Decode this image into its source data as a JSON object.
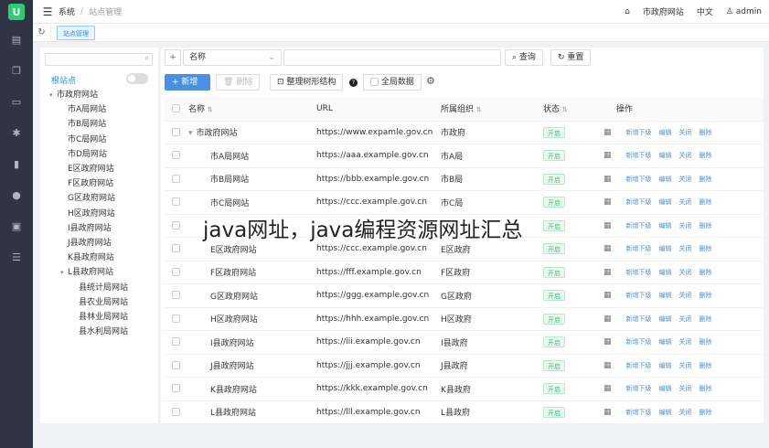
{
  "logo": "U",
  "rail": {
    "icons": [
      "document-icon",
      "copy-icon",
      "folder-icon",
      "gear-icon",
      "bar-chart-icon",
      "user-icon",
      "clipboard-icon",
      "sliders-icon"
    ]
  },
  "header": {
    "menu_label": "系统",
    "breadcrumb_current": "站点管理",
    "links": {
      "site": "市政府网站",
      "lang": "中文",
      "user": "admin"
    }
  },
  "tabs": [
    {
      "label": "站点管理"
    }
  ],
  "tree": {
    "search_placeholder": "",
    "root_label": "根站点",
    "nodes": [
      {
        "label": "市政府网站",
        "level": 0,
        "caret": "▾"
      },
      {
        "label": "市A局网站",
        "level": 1
      },
      {
        "label": "市B局网站",
        "level": 1
      },
      {
        "label": "市C局网站",
        "level": 1
      },
      {
        "label": "市D局网站",
        "level": 1
      },
      {
        "label": "E区政府网站",
        "level": 1
      },
      {
        "label": "F区政府网站",
        "level": 1
      },
      {
        "label": "G区政府网站",
        "level": 1
      },
      {
        "label": "H区政府网站",
        "level": 1
      },
      {
        "label": "I县政府网站",
        "level": 1
      },
      {
        "label": "J县政府网站",
        "level": 1
      },
      {
        "label": "K县政府网站",
        "level": 1
      },
      {
        "label": "L县政府网站",
        "level": 1,
        "caret": "▾"
      },
      {
        "label": "县统计局网站",
        "level": 2
      },
      {
        "label": "县农业局网站",
        "level": 2
      },
      {
        "label": "县林业局网站",
        "level": 2
      },
      {
        "label": "县水利局网站",
        "level": 2
      }
    ]
  },
  "filter": {
    "field_select": "名称",
    "keyword_value": "",
    "query_label": "查询",
    "reset_label": "重置"
  },
  "toolbar": {
    "add_label": "新增",
    "delete_label": "删除",
    "tree_label": "整理树形结构",
    "help_label": "?",
    "global_label": "全局数据"
  },
  "table": {
    "columns": {
      "name": "名称",
      "url": "URL",
      "org": "所属组织",
      "status": "状态",
      "ops": "操作"
    },
    "status_label": "开启",
    "op_labels": [
      "新增下级",
      "编辑",
      "关闭",
      "删除"
    ],
    "rows": [
      {
        "name": "市政府网站",
        "url": "https://www.expamle.gov.cn",
        "org": "市政府",
        "level": 0,
        "caret": "▾"
      },
      {
        "name": "市A局网站",
        "url": "https://aaa.example.gov.cn",
        "org": "市A局",
        "level": 1
      },
      {
        "name": "市B局网站",
        "url": "https://bbb.example.gov.cn",
        "org": "市B局",
        "level": 1
      },
      {
        "name": "市C局网站",
        "url": "https://ccc.example.gov.cn",
        "org": "市C局",
        "level": 1
      },
      {
        "name": "",
        "url": "",
        "org": "",
        "level": 1
      },
      {
        "name": "E区政府网站",
        "url": "https://ccc.example.gov.cn",
        "org": "E区政府",
        "level": 1
      },
      {
        "name": "F区政府网站",
        "url": "https://fff.example.gov.cn",
        "org": "F区政府",
        "level": 1
      },
      {
        "name": "G区政府网站",
        "url": "https://ggg.example.gov.cn",
        "org": "G区政府",
        "level": 1
      },
      {
        "name": "H区政府网站",
        "url": "https://hhh.example.gov.cn",
        "org": "H区政府",
        "level": 1
      },
      {
        "name": "I县政府网站",
        "url": "https://iii.example.gov.cn",
        "org": "I县政府",
        "level": 1
      },
      {
        "name": "J县政府网站",
        "url": "https://jjj.example.gov.cn",
        "org": "J县政府",
        "level": 1
      },
      {
        "name": "K县政府网站",
        "url": "https://kkk.example.gov.cn",
        "org": "K县政府",
        "level": 1
      },
      {
        "name": "L县政府网站",
        "url": "https://lll.example.gov.cn",
        "org": "L县政府",
        "level": 1
      }
    ]
  },
  "watermark": "java网址，java编程资源网址汇总",
  "colors": {
    "rail": "#2f3542",
    "accent": "#4a90e2",
    "status_green": "#2ecc71"
  }
}
